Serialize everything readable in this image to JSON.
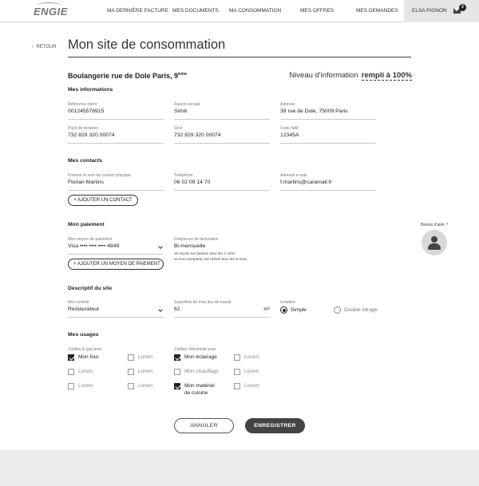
{
  "nav": {
    "logo": "ENGIE",
    "items": [
      "MA DERNIÈRE FACTURE",
      "MES DOCUMENTS",
      "MA CONSOMMATION",
      "MES OFFRES",
      "MES DEMANDES"
    ],
    "user": "ELSA PIGNON",
    "mail_count": "2"
  },
  "header": {
    "back": "RETOUR",
    "title": "Mon site de consommation"
  },
  "site": {
    "name": "Boulangerie rue de Dole  Paris, 9",
    "name_sup": "ème",
    "info_label": "Niveau d'information",
    "info_value": "rempli à 100%"
  },
  "infos": {
    "title": "Mes informations",
    "fields": [
      {
        "label": "Référence client",
        "value": "001245578915"
      },
      {
        "label": "Raison sociale",
        "value": "Simili"
      },
      {
        "label": "Adresse",
        "value": "39 rue de Dole, 75009 Paris"
      },
      {
        "label": "Point de livraison",
        "value": "732 829 320 00074"
      },
      {
        "label": "Siret",
        "value": "732 829 320 00074"
      },
      {
        "label": "Code NAF",
        "value": "12345A"
      }
    ]
  },
  "contacts": {
    "title": "Mes contacts",
    "fields": [
      {
        "label": "Prénom et nom du contact principal",
        "value": "Florian Martins"
      },
      {
        "label": "Téléphone",
        "value": "06 02 09 14 70"
      },
      {
        "label": "Adresse e-mail",
        "value": "f.martins@caramail.fr"
      }
    ],
    "add_button": "+  AJOUTER UN CONTACT"
  },
  "payment": {
    "title": "Mon paiement",
    "method_label": "Mon moyen de paiement",
    "method_value": "Visa •••• •••• •••• 4849",
    "freq_label": "Fréquence de facturation",
    "freq_value": "Bi-mensuelle",
    "note_line1": "Je reçois ma facture tous les 2 mois",
    "note_line2": "et mon compteur est relevé tous les 6 mois",
    "add_button": "+  AJOUTER UN MOYEN DE PAIEMENT"
  },
  "site_desc": {
    "title": "Descriptif du site",
    "activity_label": "Mon activité",
    "activity_value": "Restaurateur",
    "area_label": "Superficie de mon lieu de travail",
    "area_value": "62",
    "area_unit": "m²",
    "insulation_label": "Isolation",
    "option_simple": "Simple",
    "option_double": "Double vitrage"
  },
  "usages": {
    "title": "Mes usages",
    "gas_label": "J'utilise le gaz pour",
    "elec_label": "J'utilise l'électricité pour",
    "gas_col1": [
      {
        "label": "Mon four",
        "checked": true
      },
      {
        "label": "Lorem",
        "checked": false
      },
      {
        "label": "Lorem",
        "checked": false
      }
    ],
    "gas_col2": [
      {
        "label": "Lorem",
        "checked": false
      },
      {
        "label": "Lorem",
        "checked": false
      },
      {
        "label": "Lorem",
        "checked": false
      }
    ],
    "elec_col1": [
      {
        "label": "Mon éclairage",
        "checked": true
      },
      {
        "label": "Mon chauffage",
        "checked": false
      },
      {
        "label": "Mon matériel",
        "label2": "de cuisine",
        "checked": true
      }
    ],
    "elec_col2": [
      {
        "label": "Lorem",
        "checked": false
      },
      {
        "label": "Lorem",
        "checked": false
      },
      {
        "label": "Lorem",
        "checked": false
      }
    ]
  },
  "help": {
    "label": "Besoin d'aide ?"
  },
  "actions": {
    "cancel": "ANNULER",
    "save": "ENREGISTRER"
  }
}
